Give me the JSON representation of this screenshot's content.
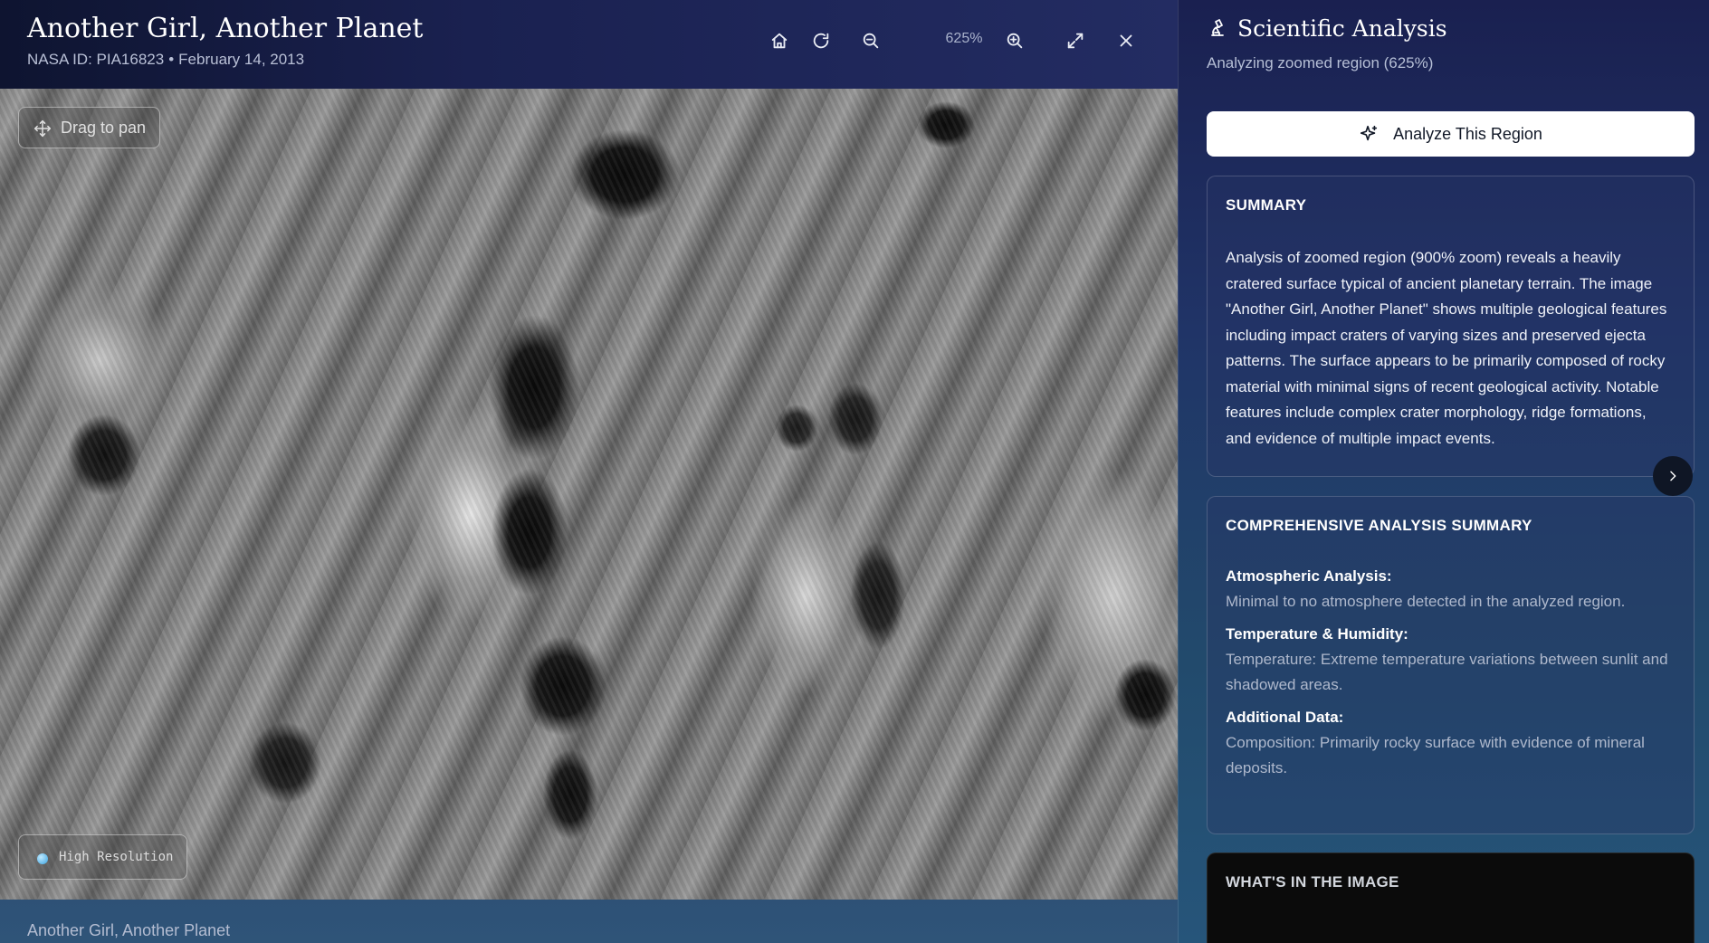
{
  "viewer": {
    "title": "Another Girl, Another Planet",
    "nasa_id": "NASA ID: PIA16823",
    "separator": "•",
    "date": "February 14, 2013",
    "zoom_label": "625%",
    "pan_hint": "Drag to pan",
    "resolution_badge": "High Resolution",
    "caption": "Another Girl, Another Planet",
    "toolbar_icons": [
      "home-icon",
      "rotate-icon",
      "zoom-out-icon",
      "zoom-in-icon",
      "fullscreen-icon",
      "close-icon"
    ]
  },
  "panel": {
    "title": "Scientific Analysis",
    "subtitle": "Analyzing zoomed region (625%)",
    "analyze_button": "Analyze This Region",
    "summary": {
      "heading": "SUMMARY",
      "text": "Analysis of zoomed region (900% zoom) reveals a heavily cratered surface typical of ancient planetary terrain. The image \"Another Girl, Another Planet\" shows multiple geological features including impact craters of varying sizes and preserved ejecta patterns. The surface appears to be primarily composed of rocky material with minimal signs of recent geological activity. Notable features include complex crater morphology, ridge formations, and evidence of multiple impact events."
    },
    "comprehensive": {
      "heading": "COMPREHENSIVE ANALYSIS SUMMARY",
      "atmospheric_label": "Atmospheric Analysis:",
      "atmospheric_text": "Minimal to no atmosphere detected in the analyzed region.",
      "temperature_label": "Temperature & Humidity:",
      "temperature_text": "Temperature: Extreme temperature variations between sunlit and shadowed areas.",
      "additional_label": "Additional Data:",
      "additional_text": "Composition: Primarily rocky surface with evidence of mineral deposits."
    },
    "whats_in_image": {
      "heading": "WHAT'S IN THE IMAGE"
    }
  }
}
